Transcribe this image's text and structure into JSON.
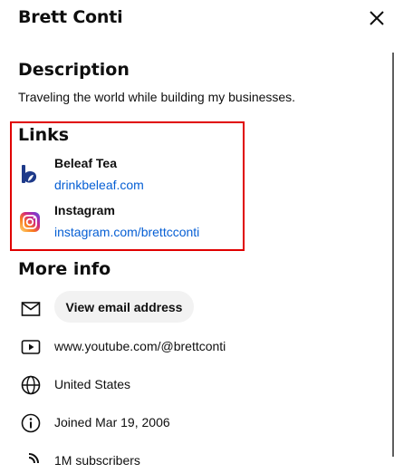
{
  "header": {
    "title": "Brett Conti"
  },
  "description": {
    "heading": "Description",
    "text": "Traveling the world while building my businesses."
  },
  "links": {
    "heading": "Links",
    "items": [
      {
        "name": "Beleaf Tea",
        "url": "drinkbeleaf.com",
        "icon": "beleaf-logo-icon"
      },
      {
        "name": "Instagram",
        "url": "instagram.com/brettcconti",
        "icon": "instagram-icon"
      }
    ],
    "highlight_color": "#e00000"
  },
  "more_info": {
    "heading": "More info",
    "email_button": "View email address",
    "channel_url": "www.youtube.com/@brettconti",
    "country": "United States",
    "joined": "Joined Mar 19, 2006",
    "partial_row": "1M subscribers"
  },
  "colors": {
    "link": "#065fd4",
    "button_bg": "#f2f2f2"
  }
}
